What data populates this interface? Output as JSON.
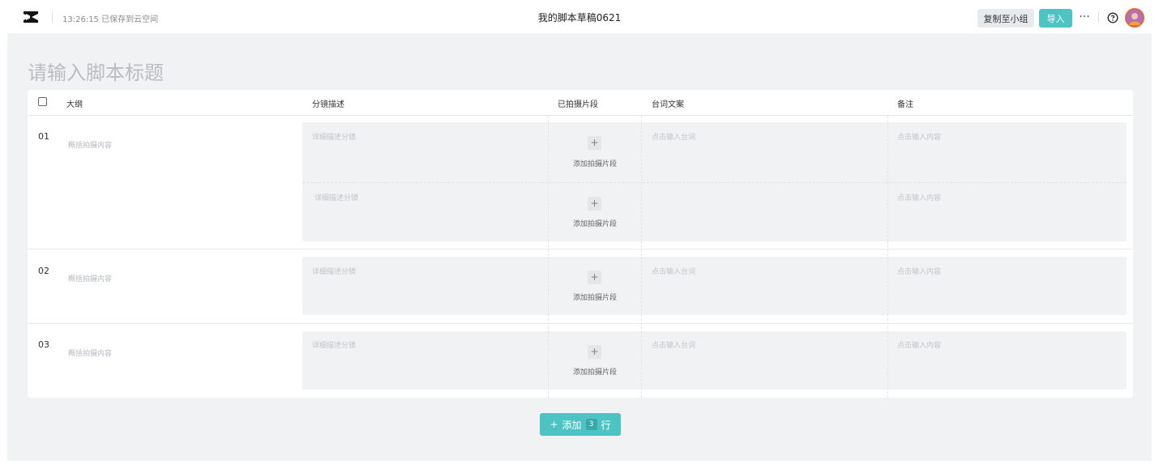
{
  "header": {
    "save_status": "13:26:15 已保存到云空间",
    "doc_title": "我的脚本草稿0621",
    "copy_button": "复制至小组",
    "import_button": "导入",
    "more_icon": "ellipsis-icon",
    "help_icon": "question-circle-icon",
    "avatar_icon": "user-avatar"
  },
  "script_title_placeholder": "请输入脚本标题",
  "columns": {
    "outline": "大纲",
    "storyboard": "分镜描述",
    "clips": "已拍摄片段",
    "lines": "台词文案",
    "notes": "备注"
  },
  "placeholders": {
    "outline": "概括拍摄内容",
    "storyboard": "详细描述分镜",
    "lines": "点击输入台词",
    "notes": "点击输入内容",
    "add_clip": "添加拍摄片段"
  },
  "rows": [
    {
      "num": "01"
    },
    {
      "num": "02"
    },
    {
      "num": "03"
    }
  ],
  "add_rows": {
    "prefix": "添加",
    "count": "3",
    "suffix": "行"
  },
  "colors": {
    "accent": "#4dc4c3",
    "canvas": "#f1f2f4"
  }
}
